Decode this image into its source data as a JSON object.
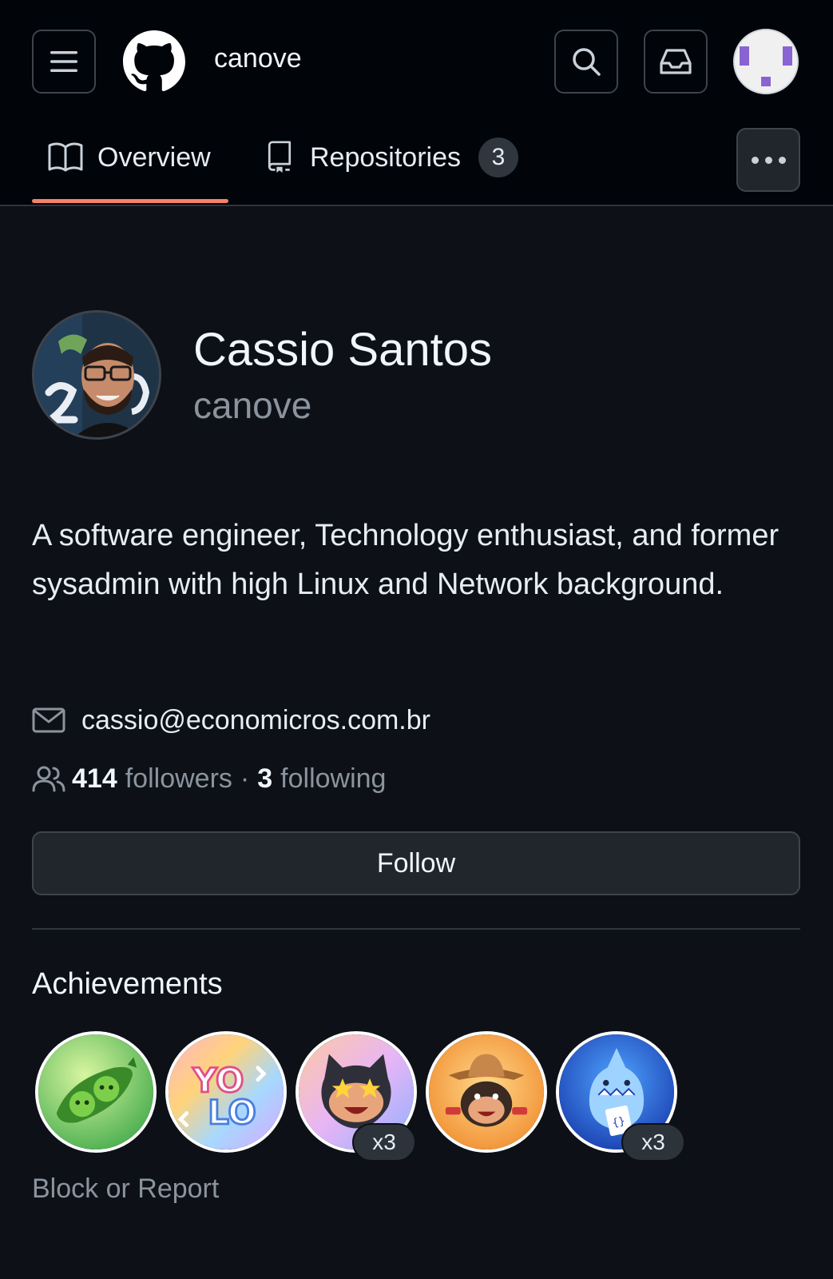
{
  "header": {
    "title": "canove",
    "icons": {
      "menu": "hamburger-menu-icon",
      "logo": "github-logo-icon",
      "search": "search-icon",
      "inbox": "inbox-icon"
    }
  },
  "tabs": [
    {
      "label": "Overview",
      "icon": "book-icon",
      "selected": true
    },
    {
      "label": "Repositories",
      "icon": "repo-icon",
      "count": "3"
    }
  ],
  "profile": {
    "full_name": "Cassio Santos",
    "login": "canove",
    "bio": "A software engineer, Technology enthusiast, and former sysadmin with high Linux and Network background.",
    "email": "cassio@economicros.com.br",
    "followers_count": "414",
    "followers_label": "followers",
    "separator": "·",
    "following_count": "3",
    "following_label": "following",
    "follow_button": "Follow"
  },
  "achievements": {
    "title": "Achievements",
    "badges": [
      {
        "name": "peas-badge"
      },
      {
        "name": "yolo-badge"
      },
      {
        "name": "starstruck-badge",
        "count": "x3"
      },
      {
        "name": "quickdraw-badge"
      },
      {
        "name": "shark-badge",
        "count": "x3"
      }
    ]
  },
  "footer": {
    "block_report": "Block or Report"
  },
  "colors": {
    "background": "#0d1117",
    "header_bg": "#010409",
    "tab_underline": "#f78166",
    "muted_text": "#8b949e"
  }
}
